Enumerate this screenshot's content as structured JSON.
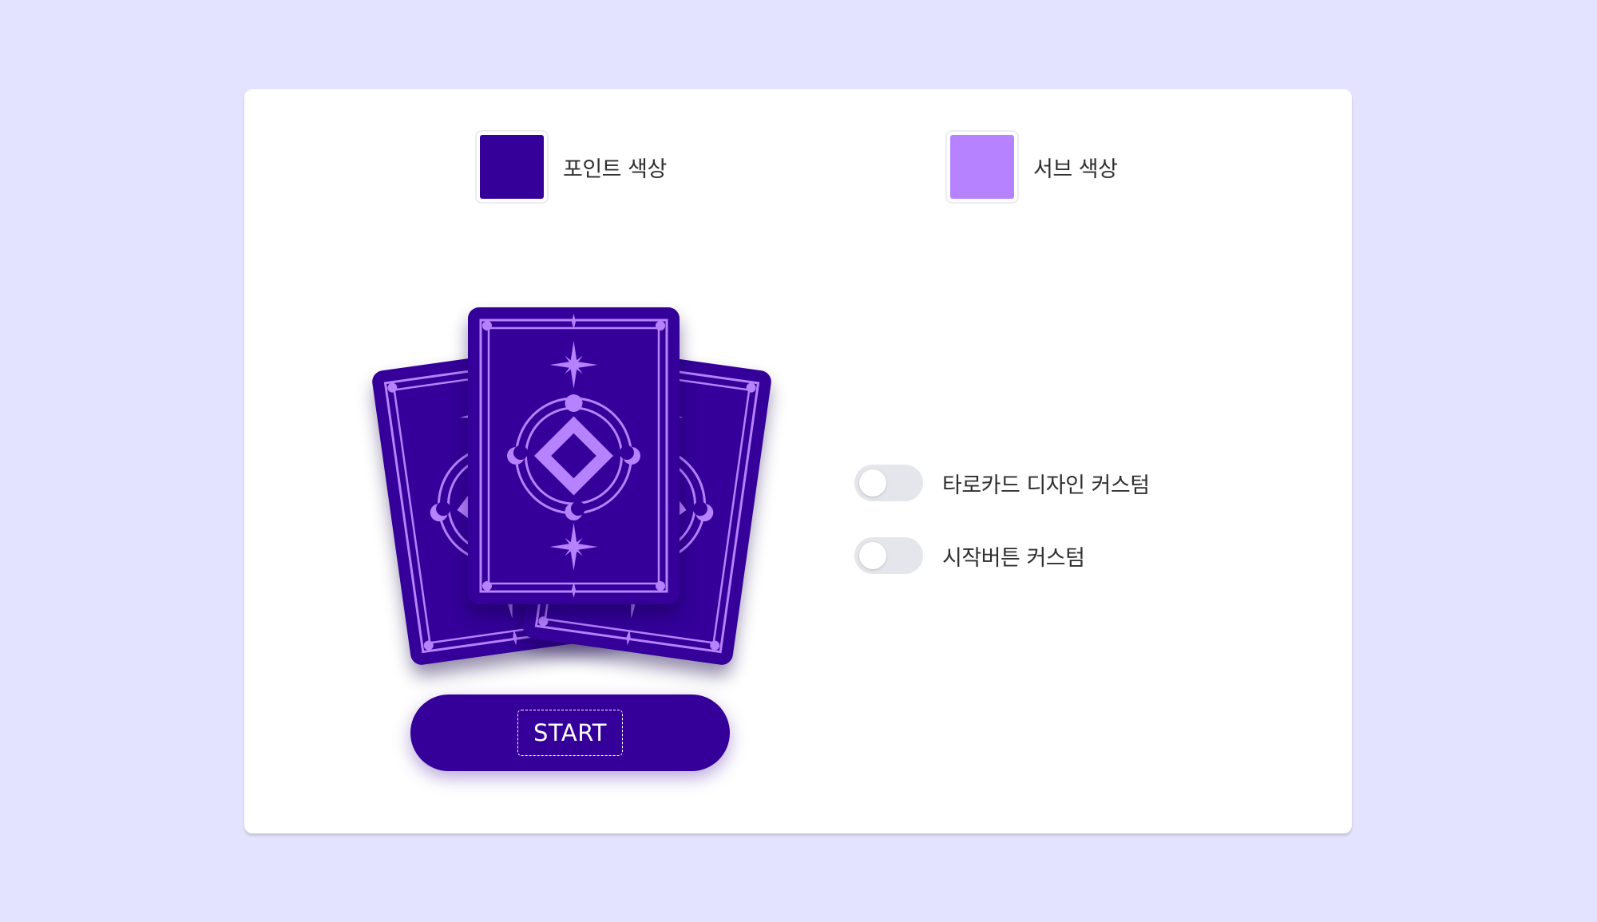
{
  "colors": {
    "background": "#e4e3ff",
    "point": "#340099",
    "sub": "#b782ff"
  },
  "color_pickers": {
    "point_label": "포인트 색상",
    "sub_label": "서브 색상"
  },
  "start_button": {
    "label": "START"
  },
  "toggles": {
    "tarot_design_label": "타로카드 디자인 커스텀",
    "tarot_design_on": false,
    "start_button_label": "시작버튼 커스텀",
    "start_button_on": false
  },
  "icons": [
    "tarot-card-icon",
    "star-icon",
    "moon-icon",
    "diamond-icon"
  ]
}
